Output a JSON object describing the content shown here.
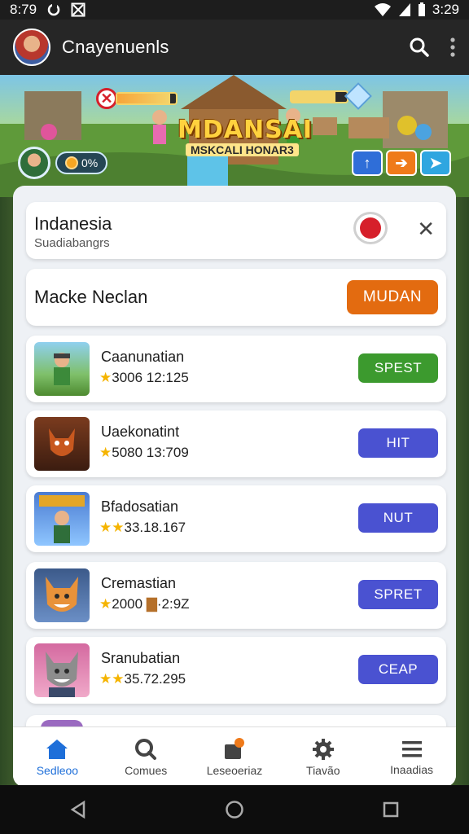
{
  "status_bar": {
    "time": "8:79",
    "right_time": "3:29"
  },
  "app_bar": {
    "title": "Cnayenuenls"
  },
  "banner": {
    "title": "MDANSAI",
    "subtitle": "MSKCALI HONAR3",
    "player_stat": "0%",
    "buttons": [
      "↑",
      "➔",
      "➤"
    ]
  },
  "location_card": {
    "title": "Indanesia",
    "subtitle": "Suadiabangrs"
  },
  "mode_card": {
    "title": "Macke Neclan",
    "button": "MUDAN"
  },
  "items": [
    {
      "name": "Caanunatian",
      "stats": "3006 12:125",
      "button": "SPEST",
      "button_color": "#3c9a2e"
    },
    {
      "name": "Uaekonatint",
      "stats": "5080 13:709",
      "button": "HIT",
      "button_color": "#4a52d1"
    },
    {
      "name": "Bfadosatian",
      "stats": "33.18.167",
      "button": "NUT",
      "button_color": "#4a52d1"
    },
    {
      "name": "Cremastian",
      "stats": "2000",
      "stats_extra": "·2:9Z",
      "button": "SPRET",
      "button_color": "#4a52d1"
    },
    {
      "name": "Sranubatian",
      "stats": "35.72.295",
      "button": "CEAP",
      "button_color": "#4a52d1"
    }
  ],
  "bottom_nav": [
    {
      "label": "Sedleoo",
      "icon": "home-icon",
      "active": true
    },
    {
      "label": "Comues",
      "icon": "search-icon",
      "active": false
    },
    {
      "label": "Leseoeriaz",
      "icon": "puzzle-icon",
      "active": false
    },
    {
      "label": "Tiavão",
      "icon": "gear-icon",
      "active": false
    },
    {
      "label": "Inaadias",
      "icon": "menu-icon",
      "active": false
    }
  ],
  "colors": {
    "accent_blue": "#1e6fd9",
    "orange": "#e36b10",
    "green": "#3c9a2e",
    "indigo": "#4a52d1"
  }
}
